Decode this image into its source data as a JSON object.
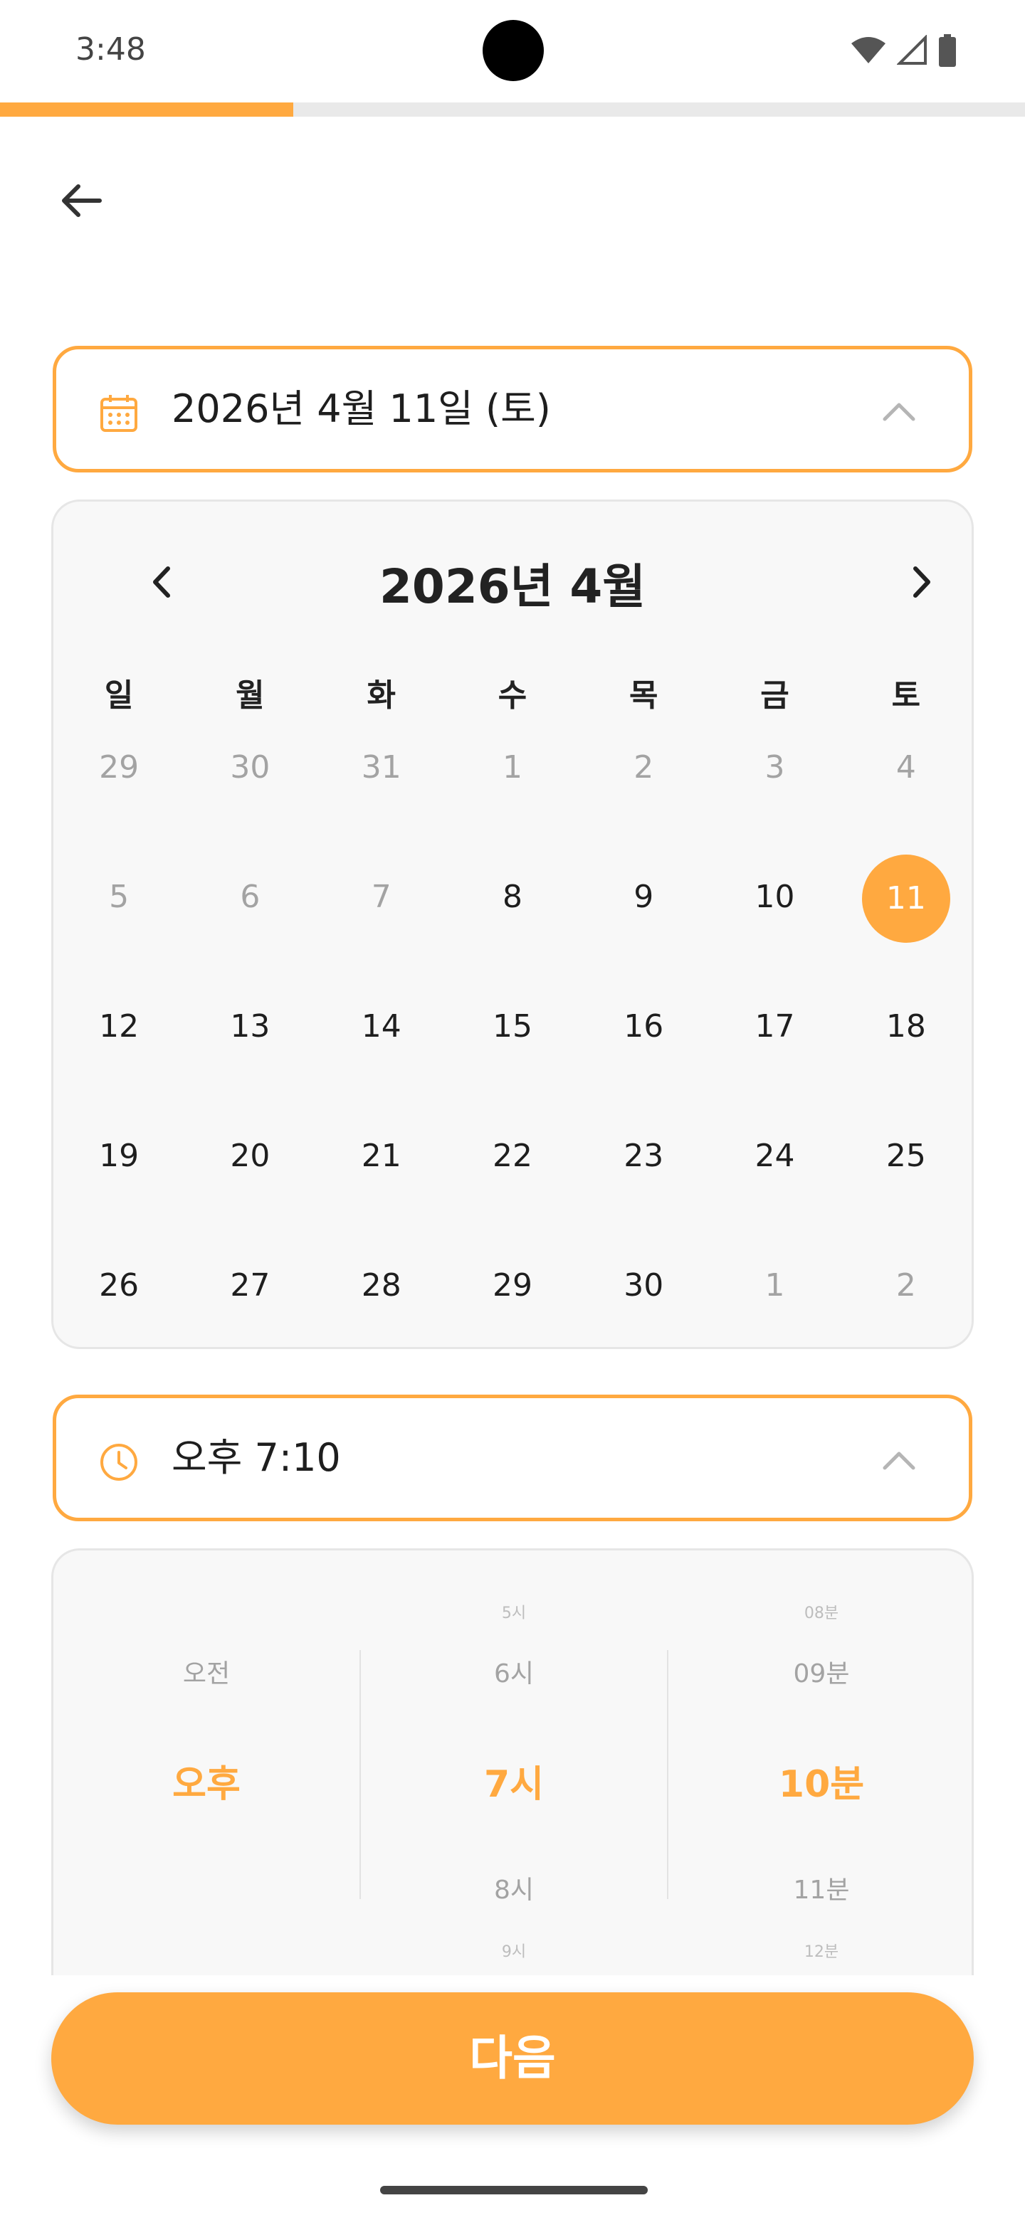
{
  "status_bar": {
    "time": "3:48"
  },
  "progress": {
    "fraction": 0.286
  },
  "date_selector": {
    "value": "2026년 4월 11일 (토)",
    "icon": "calendar-icon"
  },
  "calendar": {
    "title": "2026년 4월",
    "weekdays": [
      "일",
      "월",
      "화",
      "수",
      "목",
      "금",
      "토"
    ],
    "weeks": [
      [
        "29",
        "30",
        "31",
        "1",
        "2",
        "3",
        "4"
      ],
      [
        "5",
        "6",
        "7",
        "8",
        "9",
        "10",
        "11"
      ],
      [
        "12",
        "13",
        "14",
        "15",
        "16",
        "17",
        "18"
      ],
      [
        "19",
        "20",
        "21",
        "22",
        "23",
        "24",
        "25"
      ],
      [
        "26",
        "27",
        "28",
        "29",
        "30",
        "1",
        "2"
      ]
    ],
    "selected": "11"
  },
  "time_selector": {
    "value": "오후 7:10",
    "icon": "clock-icon"
  },
  "time_picker": {
    "ampm": {
      "above": "오전",
      "selected": "오후"
    },
    "hour": {
      "far_above": "5시",
      "above": "6시",
      "selected": "7시",
      "below": "8시",
      "far_below": "9시"
    },
    "minute": {
      "far_above": "08분",
      "above": "09분",
      "selected": "10분",
      "below": "11분",
      "far_below": "12분"
    }
  },
  "next_button": {
    "label": "다음"
  },
  "colors": {
    "accent": "#ffa940",
    "muted": "#a3a3a3",
    "panel": "#f8f8f8"
  }
}
